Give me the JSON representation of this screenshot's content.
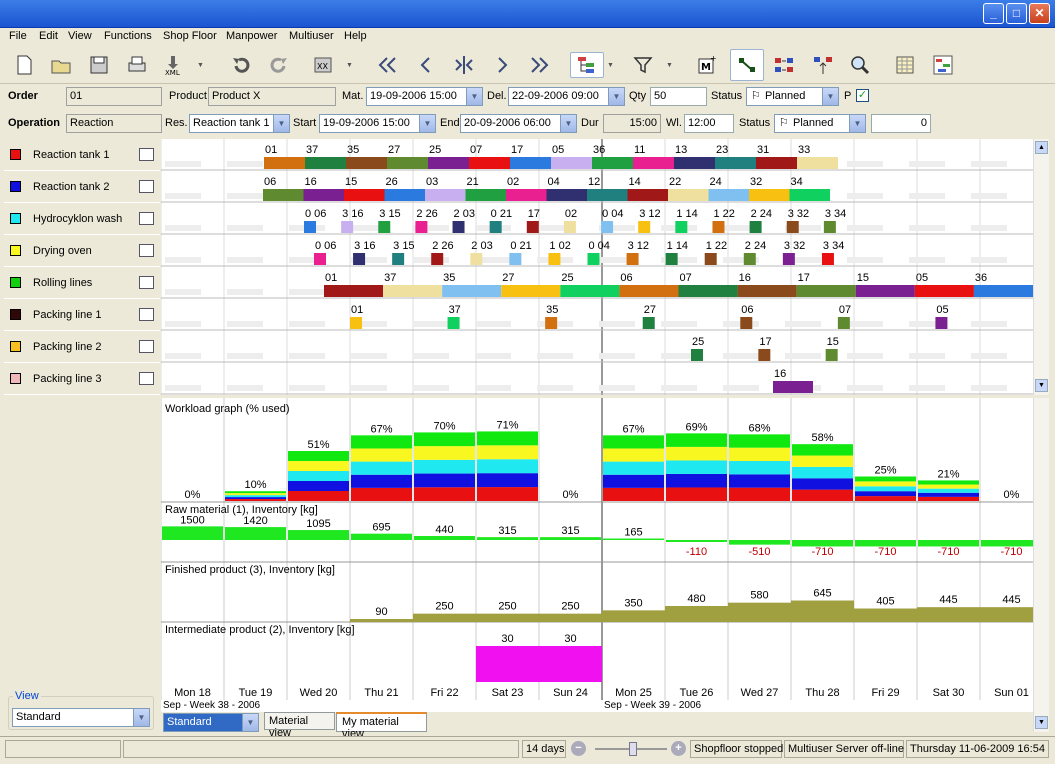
{
  "menu": [
    "File",
    "Edit",
    "View",
    "Functions",
    "Shop Floor",
    "Manpower",
    "Multiuser",
    "Help"
  ],
  "order": {
    "label": "Order",
    "value": "01",
    "product_label": "Product",
    "product": "Product X",
    "mat_label": "Mat.",
    "mat": "19-09-2006 15:00",
    "del_label": "Del.",
    "del": "22-09-2006 09:00",
    "qty_label": "Qty",
    "qty": "50",
    "status_label": "Status",
    "status": "Planned",
    "p_label": "P"
  },
  "operation": {
    "label": "Operation",
    "value": "Reaction",
    "res_label": "Res.",
    "res": "Reaction tank 1",
    "start_label": "Start",
    "start": "19-09-2006 15:00",
    "end_label": "End",
    "end": "20-09-2006 06:00",
    "dur_label": "Dur",
    "dur": "15:00",
    "wl_label": "Wl.",
    "wl": "12:00",
    "status_label": "Status",
    "status": "Planned",
    "extra": "0"
  },
  "resources": [
    {
      "name": "Reaction tank 1",
      "color": "#e81010"
    },
    {
      "name": "Reaction tank 2",
      "color": "#1010e0"
    },
    {
      "name": "Hydrocyklon wash",
      "color": "#20e8f0"
    },
    {
      "name": "Drying oven",
      "color": "#f8f820"
    },
    {
      "name": "Rolling lines",
      "color": "#10d010"
    },
    {
      "name": "Packing line 1",
      "color": "#300808"
    },
    {
      "name": "Packing line 2",
      "color": "#f8c020"
    },
    {
      "name": "Packing line 3",
      "color": "#f0b8b8"
    }
  ],
  "gantt_labels": [
    [
      "01",
      "37",
      "35",
      "27",
      "25",
      "07",
      "17",
      "05",
      "36",
      "11",
      "13",
      "23",
      "31",
      "33"
    ],
    [
      "06",
      "16",
      "15",
      "26",
      "03",
      "21",
      "02",
      "04",
      "12",
      "14",
      "22",
      "24",
      "32",
      "34"
    ],
    [
      "0 06",
      "3 16",
      "3 15",
      "2 26",
      "2 03",
      "0 21",
      "17",
      "02",
      "0 04",
      "3 12",
      "1 14",
      "1 22",
      "2 24",
      "3 32",
      "3 34"
    ],
    [
      "0 06",
      "3 16",
      "3 15",
      "2 26",
      "2 03",
      "0 21",
      "1 02",
      "0 04",
      "3 12",
      "1 14",
      "1 22",
      "2 24",
      "3 32",
      "3 34"
    ],
    [
      "01",
      "37",
      "35",
      "27",
      "25",
      "06",
      "07",
      "16",
      "17",
      "15",
      "05",
      "36"
    ],
    [
      "01",
      "37",
      "35",
      "27",
      "06",
      "07",
      "05"
    ],
    [
      "25",
      "17",
      "15"
    ],
    [
      "16"
    ]
  ],
  "workload": {
    "title": "Workload graph (% used)",
    "values": [
      "0%",
      "10%",
      "51%",
      "67%",
      "70%",
      "71%",
      "0%",
      "67%",
      "69%",
      "68%",
      "58%",
      "25%",
      "21%",
      "0%"
    ]
  },
  "raw": {
    "title": "Raw material (1), Inventory [kg]",
    "values": [
      "1500",
      "1420",
      "1095",
      "695",
      "440",
      "315",
      "315",
      "165",
      "-110",
      "-510",
      "-710",
      "-710",
      "-710",
      "-710"
    ]
  },
  "finished": {
    "title": "Finished product (3), Inventory [kg]",
    "values": [
      "",
      "",
      "",
      "90",
      "250",
      "250",
      "250",
      "350",
      "480",
      "580",
      "645",
      "405",
      "445",
      "445"
    ]
  },
  "intermediate": {
    "title": "Intermediate product (2), Inventory [kg]",
    "values": [
      "",
      "",
      "",
      "",
      "",
      "30",
      "30",
      "",
      "",
      "",
      "",
      "",
      "",
      ""
    ]
  },
  "days": [
    "Mon 18",
    "Tue 19",
    "Wed 20",
    "Thu 21",
    "Fri 22",
    "Sat 23",
    "Sun 24",
    "Mon 25",
    "Tue 26",
    "Wed 27",
    "Thu 28",
    "Fri 29",
    "Sat 30",
    "Sun 01"
  ],
  "weeks": [
    "Sep - Week 38 - 2006",
    "Sep - Week 39 - 2006"
  ],
  "view": {
    "label": "View",
    "value": "Standard"
  },
  "tabs": {
    "select": "Standard",
    "material": "Material view",
    "my_material": "My material view"
  },
  "status": {
    "span": "14 days",
    "shopfloor": "Shopfloor stopped",
    "multiuser": "Multiuser Server off-line",
    "datetime": "Thursday 11-06-2009 16:54"
  }
}
